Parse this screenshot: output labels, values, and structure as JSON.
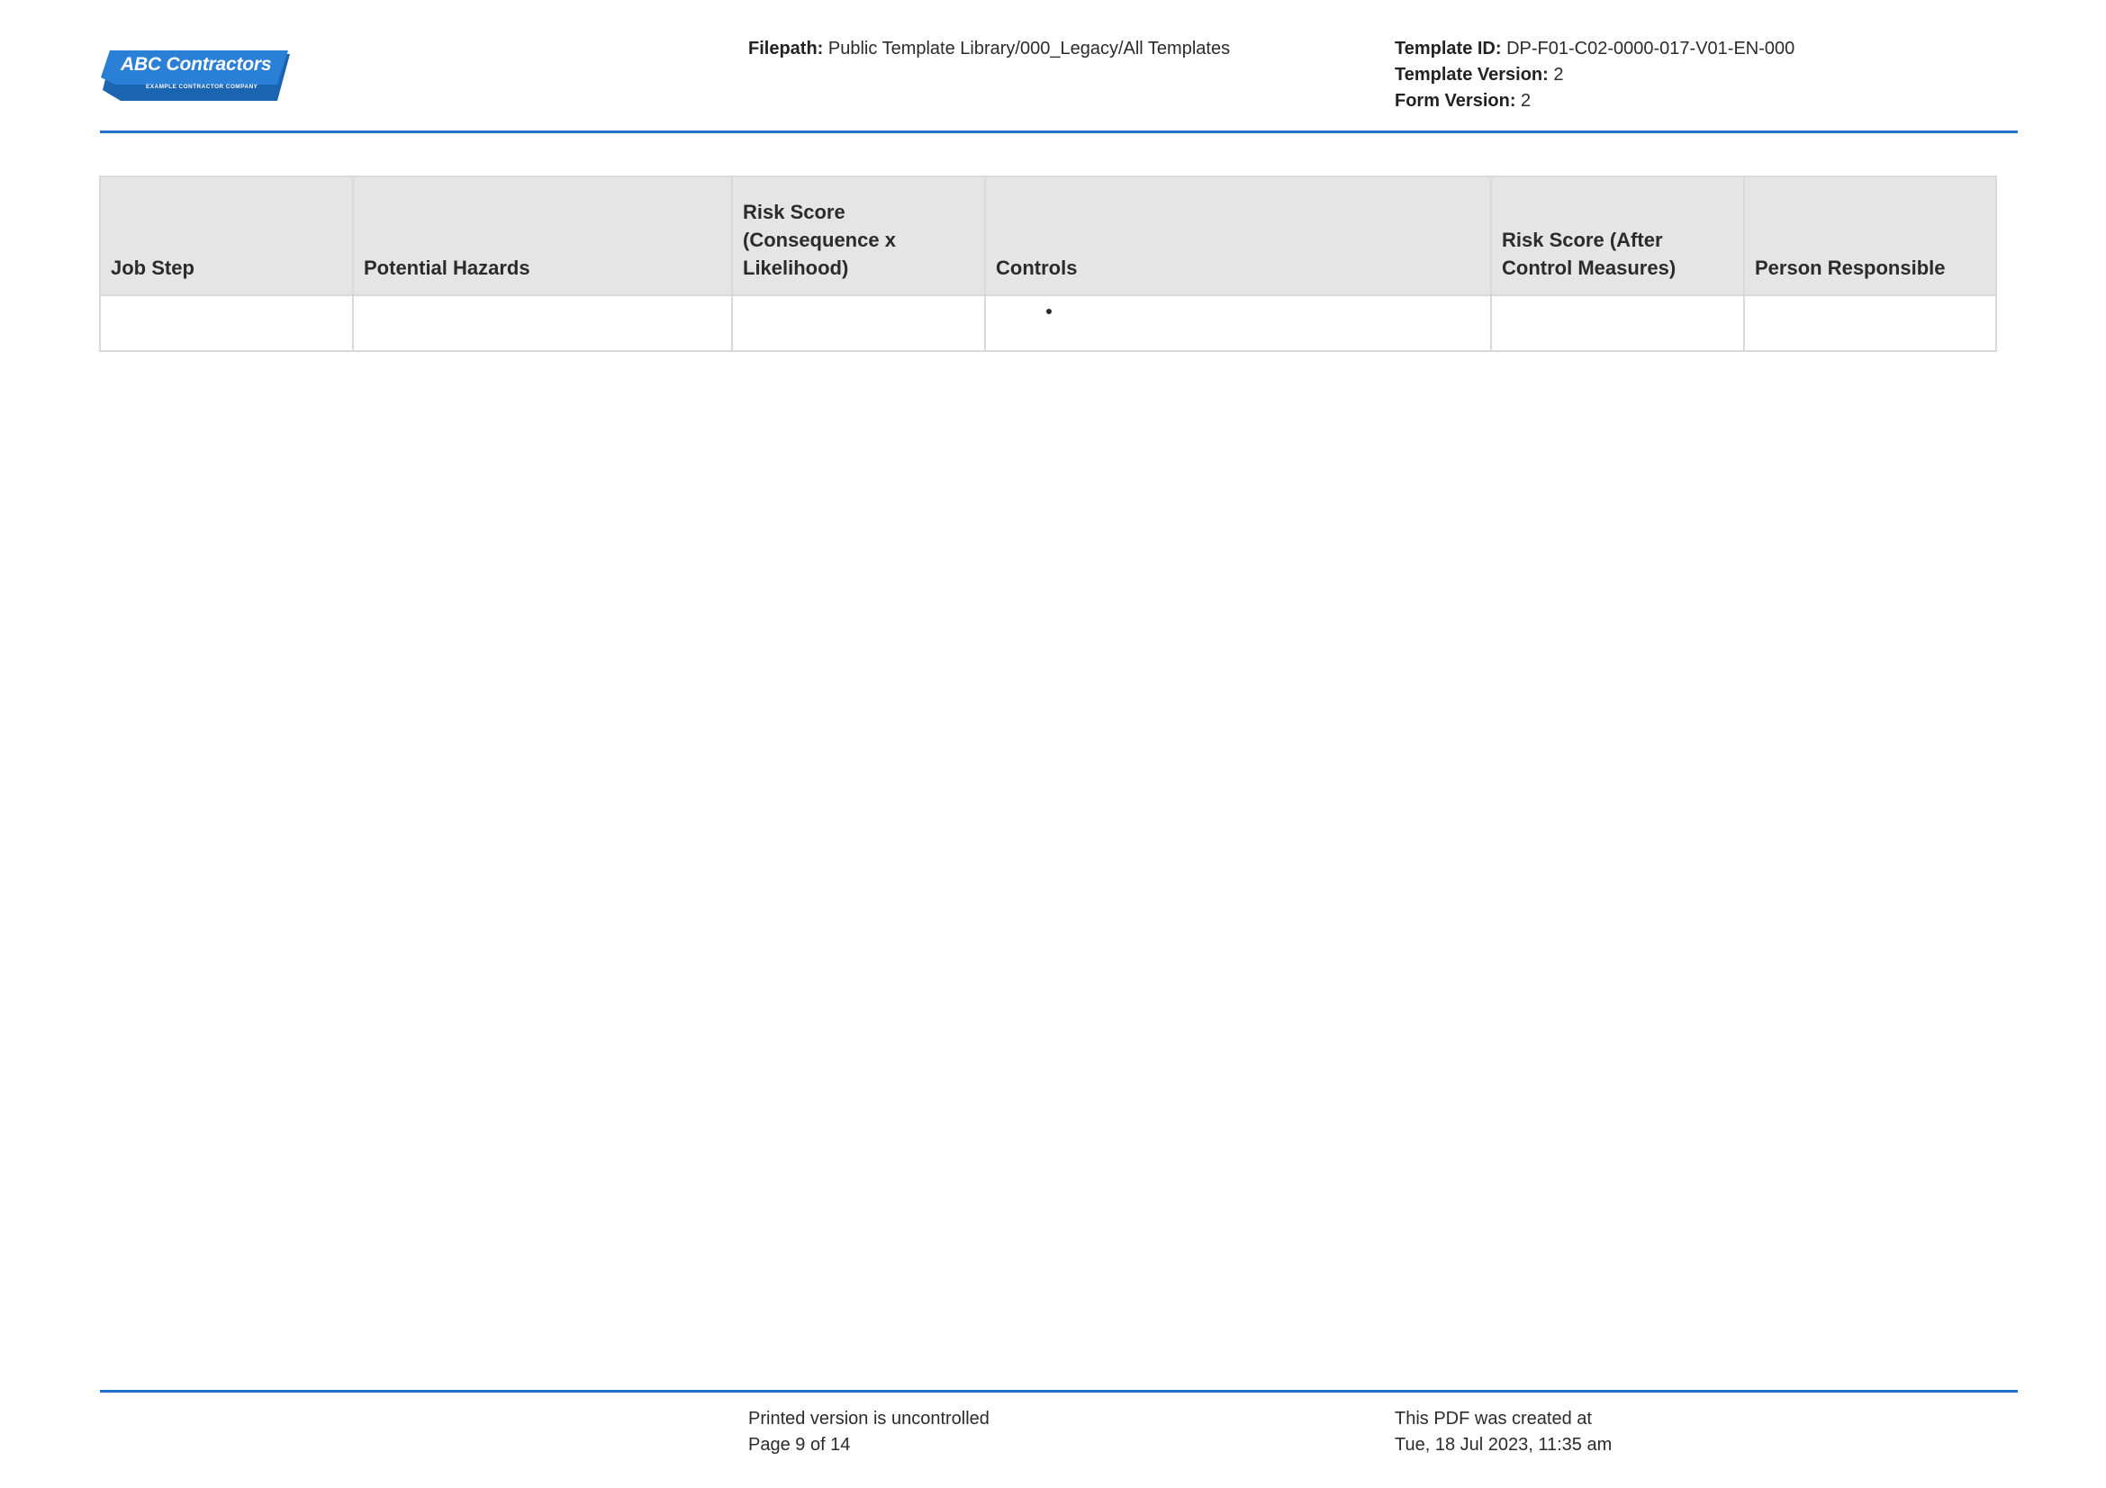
{
  "header": {
    "logo": {
      "name": "ABC Contractors",
      "tagline": "EXAMPLE CONTRACTOR COMPANY",
      "color": "#1e73c8"
    },
    "filepath_label": "Filepath:",
    "filepath_value": "Public Template Library/000_Legacy/All Templates",
    "template_id_label": "Template ID:",
    "template_id_value": "DP-F01-C02-0000-017-V01-EN-000",
    "template_version_label": "Template Version:",
    "template_version_value": "2",
    "form_version_label": "Form Version:",
    "form_version_value": "2"
  },
  "table": {
    "columns": [
      "Job Step",
      "Potential Hazards",
      "Risk Score (Consequence x Likelihood)",
      "Controls",
      "Risk Score (After Control Measures)",
      "Person Responsible"
    ],
    "rows": [
      [
        "",
        "",
        "",
        "",
        "",
        ""
      ]
    ]
  },
  "footer": {
    "line1": "Printed version is uncontrolled",
    "line2": "Page 9 of 14",
    "created_line1": "This PDF was created at",
    "created_line2": "Tue, 18 Jul 2023, 11:35 am"
  },
  "colors": {
    "accent": "#1e73c8",
    "header_fill": "#e5e5e5",
    "border": "#d9d9d9"
  }
}
